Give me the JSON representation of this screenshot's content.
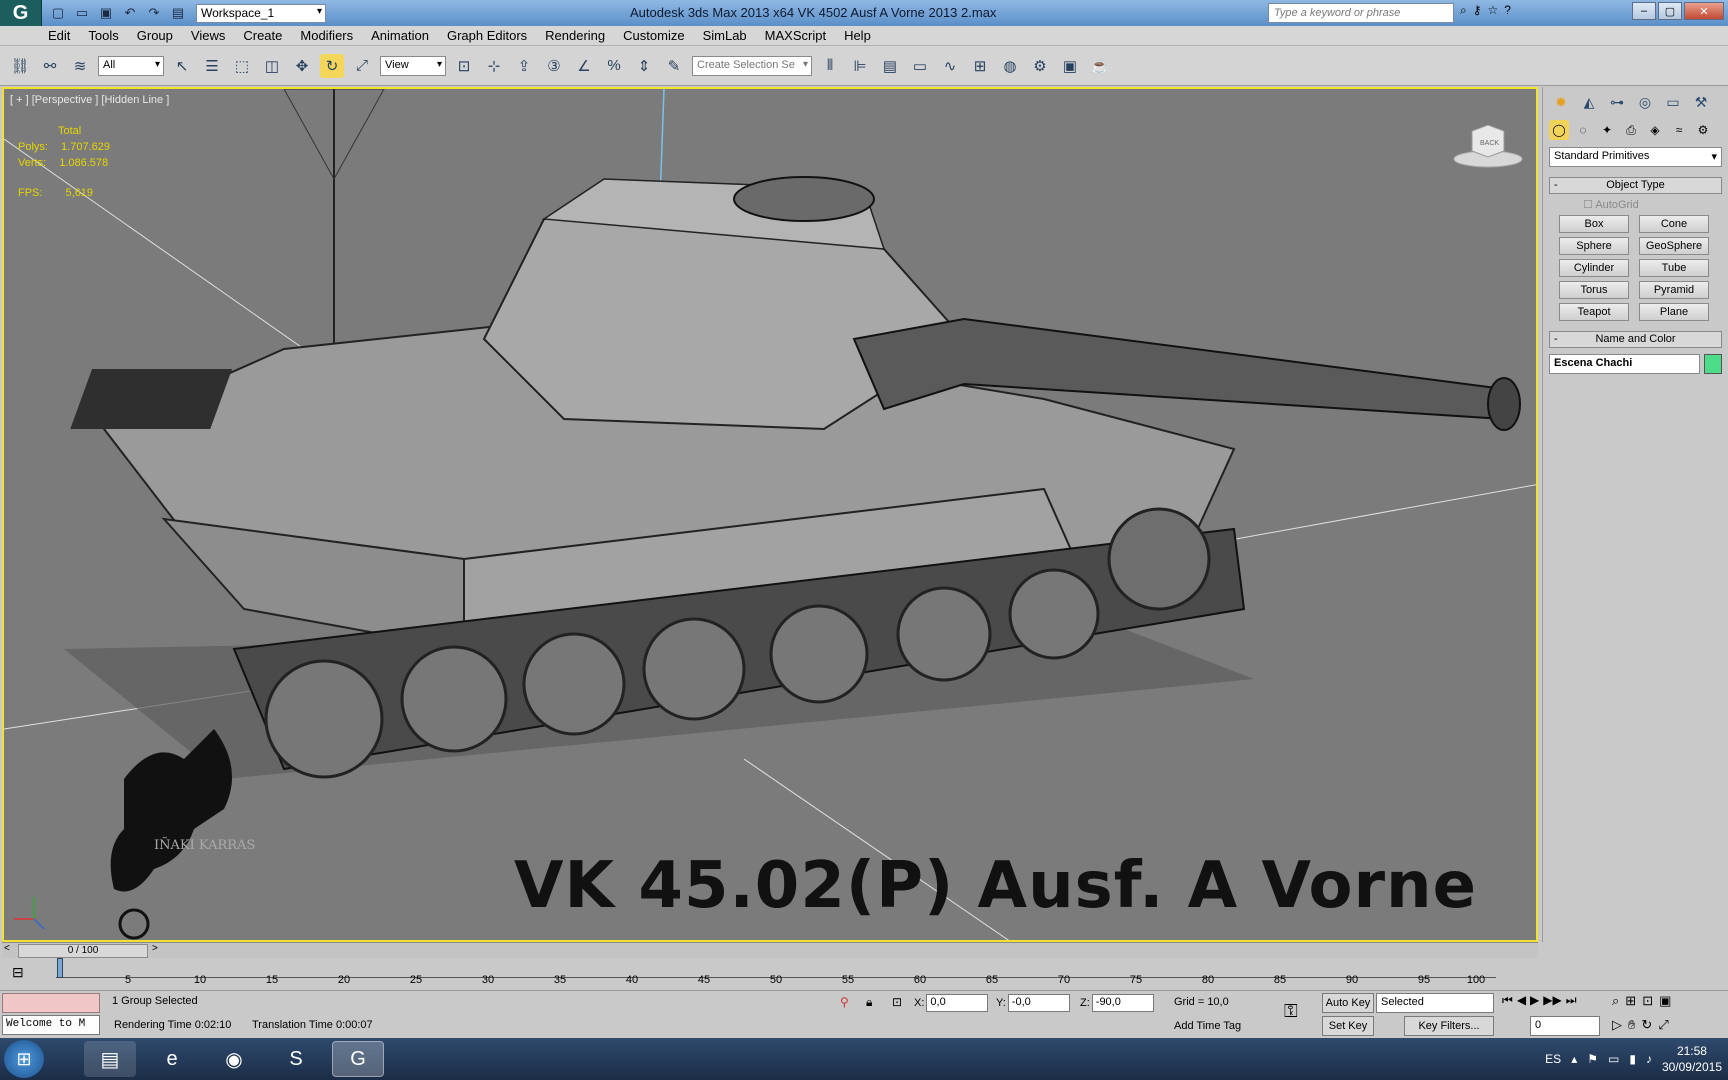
{
  "window": {
    "title": "Autodesk 3ds Max  2013 x64      VK 4502  Ausf A  Vorne 2013 2.max",
    "workspace": "Workspace_1",
    "search_placeholder": "Type a keyword or phrase"
  },
  "menu": [
    "Edit",
    "Tools",
    "Group",
    "Views",
    "Create",
    "Modifiers",
    "Animation",
    "Graph Editors",
    "Rendering",
    "Customize",
    "SimLab",
    "MAXScript",
    "Help"
  ],
  "toolbar": {
    "filter": "All",
    "ref_coord": "View",
    "selection_set_placeholder": "Create Selection Se"
  },
  "viewport": {
    "label": "[ + ] [Perspective ] [Hidden Line ]",
    "stats_header": "Total",
    "polys_label": "Polys:",
    "polys_value": "1.707.629",
    "verts_label": "Verts:",
    "verts_value": "1.086.578",
    "fps_label": "FPS:",
    "fps_value": "5,619",
    "title_text": "VK 45.02(P)  Ausf. A   Vorne",
    "watermark_name": "IÑAKI KARRAS",
    "viewcube_label": "BACK"
  },
  "command_panel": {
    "category": "Standard Primitives",
    "object_type_title": "Object Type",
    "autogrid": "AutoGrid",
    "buttons": [
      "Box",
      "Cone",
      "Sphere",
      "GeoSphere",
      "Cylinder",
      "Tube",
      "Torus",
      "Pyramid",
      "Teapot",
      "Plane"
    ],
    "name_color_title": "Name and Color",
    "object_name": "Escena Chachi",
    "object_color": "#4ddc8a"
  },
  "time_slider": {
    "label": "0 / 100"
  },
  "trackbar_ticks": [
    "5",
    "10",
    "15",
    "20",
    "25",
    "30",
    "35",
    "40",
    "45",
    "50",
    "55",
    "60",
    "65",
    "70",
    "75",
    "80",
    "85",
    "90",
    "95",
    "100"
  ],
  "status": {
    "welcome": "Welcome to M",
    "selection": "1 Group Selected",
    "render_time": "Rendering Time  0:02:10",
    "translation_time": "Translation Time  0:00:07",
    "x_value": "0,0",
    "y_value": "-0,0",
    "z_value": "-90,0",
    "grid": "Grid = 10,0",
    "add_time_tag": "Add Time Tag",
    "auto_key": "Auto Key",
    "set_key": "Set Key",
    "key_mode": "Selected",
    "key_filters": "Key Filters...",
    "frame": "0"
  },
  "taskbar": {
    "language": "ES",
    "time": "21:58",
    "date": "30/09/2015"
  }
}
